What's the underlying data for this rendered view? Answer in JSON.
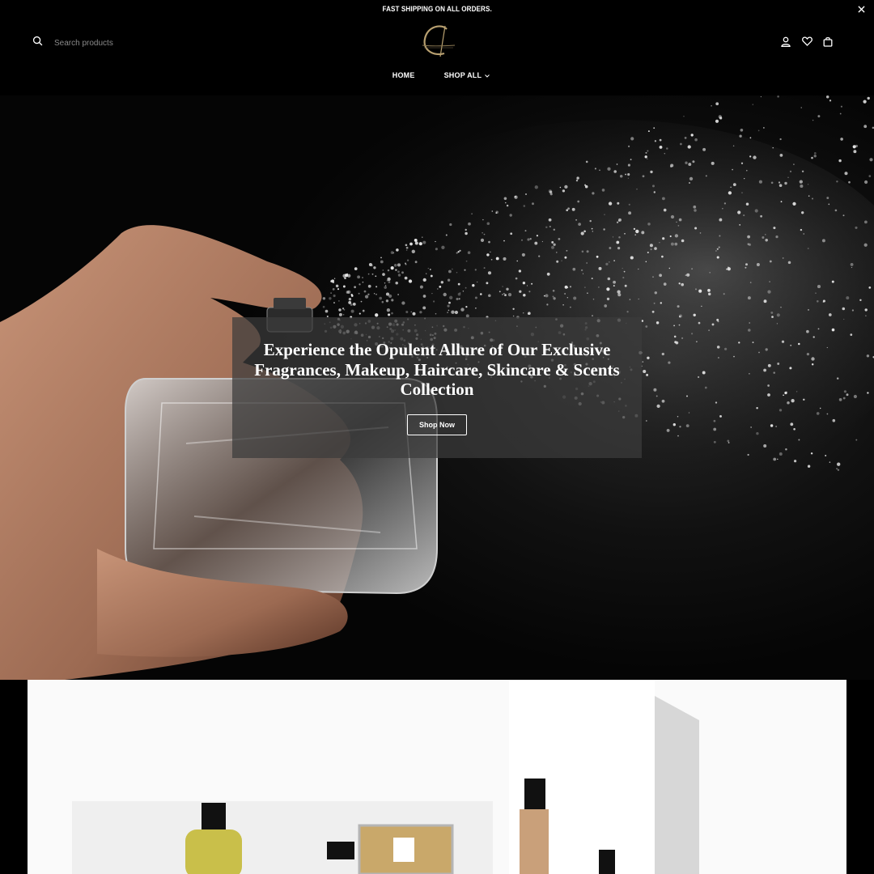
{
  "announcement": {
    "text": "FAST SHIPPING ON ALL ORDERS.",
    "close_icon": "close-icon"
  },
  "header": {
    "search_placeholder": "Search products",
    "logo_icon": "brand-logo",
    "icons": [
      "account-icon",
      "wishlist-icon",
      "cart-icon"
    ]
  },
  "nav": {
    "items": [
      {
        "label": "HOME"
      },
      {
        "label": "SHOP ALL",
        "icon": "chevron-down-icon"
      }
    ]
  },
  "hero": {
    "title": "Experience the Opulent Allure of Our Exclusive Fragrances, Makeup, Haircare, Skincare & Scents Collection",
    "button_label": "Shop Now"
  },
  "colors": {
    "background": "#000000",
    "text": "#ffffff",
    "logo_gold": "#b8a070",
    "banner_bg": "#fafafa"
  }
}
